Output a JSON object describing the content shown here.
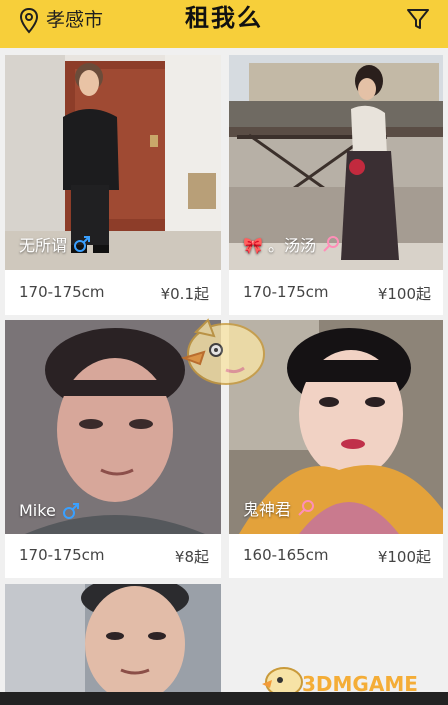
{
  "header": {
    "city": "孝感市",
    "title": "租我么",
    "location_icon": "location-pin-icon",
    "filter_icon": "filter-funnel-icon",
    "bg_color": "#f7cf3a"
  },
  "cards": [
    {
      "name": "无所谓",
      "gender": "male",
      "height": "170-175cm",
      "price": "¥0.1起"
    },
    {
      "name": "🎀 。汤汤",
      "gender": "female",
      "height": "170-175cm",
      "price": "¥100起"
    },
    {
      "name": "Mike",
      "gender": "male",
      "height": "170-175cm",
      "price": "¥8起"
    },
    {
      "name": "鬼神君",
      "gender": "female",
      "height": "160-165cm",
      "price": "¥100起"
    },
    {
      "name": "",
      "gender": "",
      "height": "",
      "price": ""
    }
  ],
  "gender_colors": {
    "male": "#3aa0ff",
    "female": "#ff8fb8"
  },
  "watermark": {
    "text": "3DMGAME"
  }
}
